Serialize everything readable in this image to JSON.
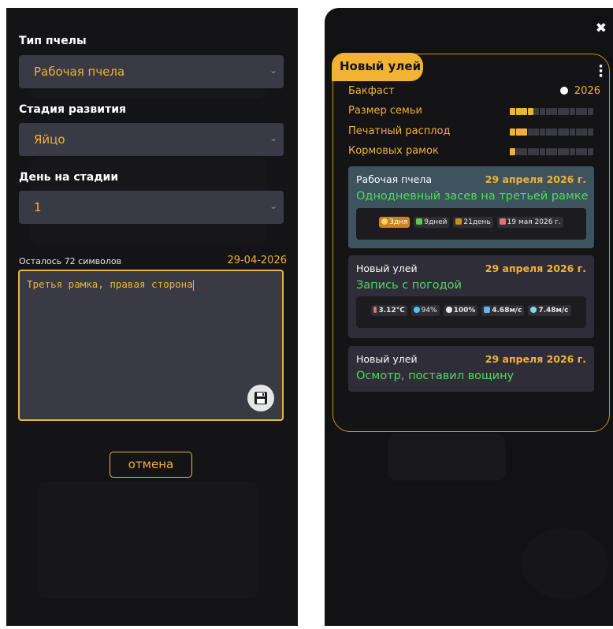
{
  "form": {
    "bee_type_label": "Тип пчелы",
    "bee_type_value": "Рабочая пчела",
    "stage_label": "Стадия развития",
    "stage_value": "Яйцо",
    "day_label": "День на стадии",
    "day_value": "1",
    "chars_left": "Осталось 72 символов",
    "date": "29-04-2026",
    "note_text": "Третья рамка, правая сторона",
    "cancel_label": "отмена"
  },
  "hive": {
    "name": "Новый улей",
    "breed": "Бакфаст",
    "year": "2026",
    "stats": [
      {
        "label": "Размер семьи",
        "filled": 4,
        "total": 14
      },
      {
        "label": "Печатный расплод",
        "filled": 3,
        "total": 14
      },
      {
        "label": "Кормовых рамок",
        "filled": 1,
        "total": 14
      }
    ],
    "entries": [
      {
        "who": "Рабочая пчела",
        "when": "29 апреля 2026 г.",
        "title": "Однодневный засев на третьей рамке",
        "chips": [
          "3дня",
          "9дней",
          "21день",
          "19 мая 2026 г."
        ]
      },
      {
        "who": "Новый улей",
        "when": "29 апреля 2026 г.",
        "title": "Запись с погодой",
        "chips": [
          "3.12°C",
          "94%",
          "100%",
          "4.68м/с",
          "7.48м/с"
        ]
      },
      {
        "who": "Новый улей",
        "when": "29 апреля 2026 г.",
        "title": "Осмотр, поставил вощину"
      }
    ]
  },
  "colors": {
    "accent": "#f2b233",
    "green": "#4fdc5a",
    "field_bg": "#3a3a44",
    "bar_empty": "#3a3a44"
  },
  "icons": {
    "close": "close-icon",
    "menu": "kebab-menu-icon",
    "save": "save-icon",
    "chevron": "chevron-down-icon"
  }
}
